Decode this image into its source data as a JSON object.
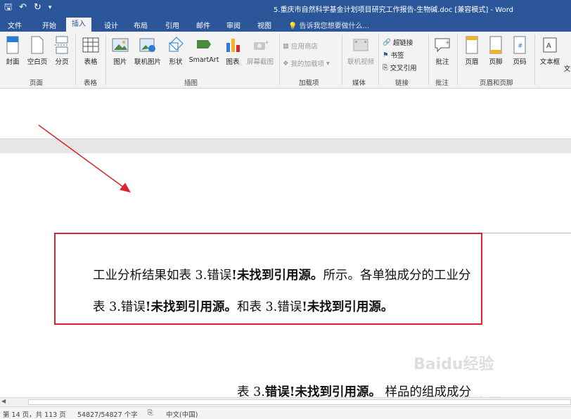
{
  "window": {
    "title": "5.重庆市自然科学基金计划项目研究工作报告-生物碱.doc [兼容模式] - Word",
    "qat": {
      "save_icon": "save-icon",
      "undo_label": "↶",
      "redo_label": "↻"
    }
  },
  "tabs": [
    "文件",
    "开始",
    "插入",
    "设计",
    "布局",
    "引用",
    "邮件",
    "审阅",
    "视图"
  ],
  "tell_me": "告诉我您想要做什么...",
  "ribbon": {
    "pages": {
      "cover": "封面",
      "blank": "空白页",
      "break": "分页",
      "group": "页面"
    },
    "tables": {
      "table": "表格",
      "group": "表格"
    },
    "illustrations": {
      "picture": "图片",
      "online_picture": "联机图片",
      "shapes": "形状",
      "smartart": "SmartArt",
      "chart": "图表",
      "screenshot": "屏幕截图",
      "group": "插图"
    },
    "addins": {
      "store": "应用商店",
      "my_addins": "我的加载项",
      "group": "加载项"
    },
    "media": {
      "online_video": "联机视频",
      "group": "媒体"
    },
    "links": {
      "hyperlink": "超链接",
      "bookmark": "书签",
      "crossref": "交叉引用",
      "group": "链接"
    },
    "comments": {
      "comment": "批注",
      "group": "批注"
    },
    "header_footer": {
      "header": "页眉",
      "footer": "页脚",
      "page_number": "页码",
      "group": "页眉和页脚"
    },
    "text": {
      "textbox": "文本框",
      "more": "文"
    }
  },
  "document": {
    "line1_prefix": "工业分析结果如表  3.",
    "line1_error": "错误",
    "line1_bold": "!未找到引用源。",
    "line1_suffix": "所示。各单独成分的工业分",
    "line2_prefix": "表  3.",
    "line2_error": "错误",
    "line2_bold": "!未找到引用源。",
    "line2_mid": "和表  3.",
    "line2_error2": "错误",
    "line2_bold2": "!未找到引用源。",
    "caption_prefix": "表  3.",
    "caption_bold": "错误!未找到引用源。",
    "caption_suffix": "  样品的组成成分"
  },
  "status": {
    "page": "第 14 页，共 113 页",
    "words": "54827/54827 个字",
    "lang": "中文(中国)"
  },
  "watermark": {
    "main": "Baidu经验",
    "sub": "jingyan.baidu.com"
  },
  "colors": {
    "word_blue": "#2b579a",
    "highlight_red": "#d9252b"
  }
}
